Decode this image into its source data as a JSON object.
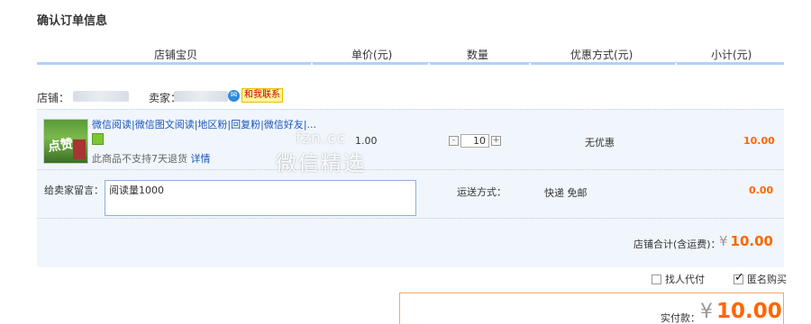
{
  "page_title": "确认订单信息",
  "columns": {
    "item": "店铺宝贝",
    "unit_price": "单价(元)",
    "quantity": "数量",
    "discount": "优惠方式(元)",
    "subtotal": "小计(元)"
  },
  "shop": {
    "shop_label": "店铺：",
    "seller_label": "卖家：",
    "contact_label": "和我联系"
  },
  "item": {
    "thumb_text": "点赞",
    "title": "微信阅读|微信图文阅读|地区粉|回复粉|微信好友|...",
    "note": "此商品不支持7天退货",
    "detail_link": "详情",
    "unit_price": "1.00",
    "quantity": "10",
    "discount": "无优惠",
    "subtotal": "10.00"
  },
  "watermark": {
    "line1": "fzn.cc",
    "line2": "微信精选"
  },
  "message": {
    "label": "给卖家留言：",
    "value": "阅读量1000"
  },
  "shipping": {
    "label": "运送方式：",
    "method": "快递 免邮",
    "fee": "0.00"
  },
  "shop_total": {
    "label": "店铺合计(含运费)：",
    "currency": "¥",
    "amount": "10.00"
  },
  "options": {
    "proxy_pay": {
      "label": "找人代付",
      "checked": false
    },
    "anonymous": {
      "label": "匿名购买",
      "checked": true
    }
  },
  "payment": {
    "label": "实付款：",
    "currency": "¥",
    "amount": "10.00"
  },
  "colors": {
    "accent_orange": "#ff6600",
    "header_rule": "#b2d1ff",
    "item_bg": "#f1f6fc",
    "link_blue": "#1a55b8"
  }
}
